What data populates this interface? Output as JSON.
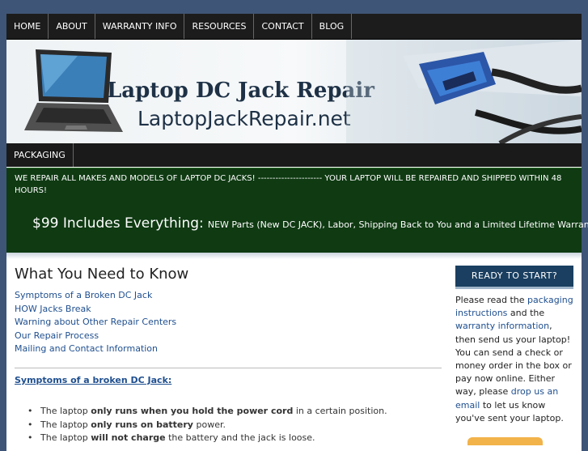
{
  "nav": [
    "HOME",
    "ABOUT",
    "WARRANTY INFO",
    "RESOURCES",
    "CONTACT",
    "BLOG"
  ],
  "banner": {
    "title": "Laptop DC Jack Repair",
    "domain": "LaptopJackRepair.net"
  },
  "subnav": [
    "PACKAGING"
  ],
  "promo": {
    "line1": "WE REPAIR ALL MAKES AND MODELS OF LAPTOP DC JACKS! ---------------------- YOUR LAPTOP WILL BE REPAIRED AND SHIPPED WITHIN 48 HOURS!",
    "big": "$99 Includes Everything:",
    "small": "NEW Parts (New DC JACK), Labor, Shipping Back to You and a Limited Lifetime Warranty."
  },
  "main": {
    "heading": "What You Need to Know",
    "links": [
      "Symptoms of a Broken DC Jack",
      "HOW Jacks Break",
      "Warning about Other Repair Centers",
      "Our Repair Process",
      "Mailing and Contact Information"
    ],
    "symptoms_heading": "Symptoms of a broken DC Jack:",
    "bullets": [
      {
        "pre": "The laptop ",
        "bold": "only runs when you hold the power cord",
        "post": " in a certain position."
      },
      {
        "pre": "The laptop ",
        "bold": "only runs on battery",
        "post": " power."
      },
      {
        "pre": "The laptop ",
        "bold": "will not charge",
        "post": " the battery and the jack is loose."
      }
    ]
  },
  "sidebar": {
    "ready": "READY TO START?",
    "t1": "Please read the ",
    "l1": "packaging instructions",
    "t2": " and the ",
    "l2": "warranty information",
    "t3": ", then send us your laptop! You can send a check or money order in the box or pay now online. Either way, please ",
    "l3": "drop us an email",
    "t4": " to let us know you've sent your laptop."
  },
  "colors": {
    "nav_bg": "#1c1c1c",
    "promo_bg": "#0f3a12",
    "link": "#1f4f8f",
    "accent_orange": "#f2b34a"
  }
}
